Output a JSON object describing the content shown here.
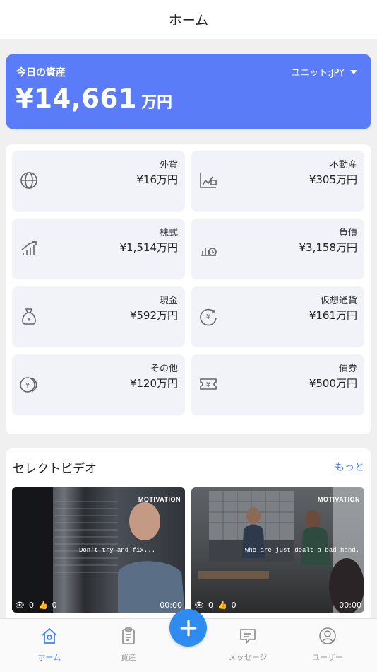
{
  "header": {
    "title": "ホーム"
  },
  "summary": {
    "label": "今日の資産",
    "unit_selector": "ユニット:JPY",
    "total": "¥14,661",
    "total_unit": "万円"
  },
  "categories": [
    {
      "name": "外貨",
      "value": "¥16万円",
      "icon": "globe-icon"
    },
    {
      "name": "不動産",
      "value": "¥305万円",
      "icon": "real-estate-chart-icon"
    },
    {
      "name": "株式",
      "value": "¥1,514万円",
      "icon": "stock-trend-icon"
    },
    {
      "name": "負債",
      "value": "¥3,158万円",
      "icon": "debt-clock-icon"
    },
    {
      "name": "現金",
      "value": "¥592万円",
      "icon": "money-bag-icon"
    },
    {
      "name": "仮想通貨",
      "value": "¥161万円",
      "icon": "crypto-yen-icon"
    },
    {
      "name": "その他",
      "value": "¥120万円",
      "icon": "coins-icon"
    },
    {
      "name": "債券",
      "value": "¥500万円",
      "icon": "bond-ticket-icon"
    }
  ],
  "videos": {
    "heading": "セレクトビデオ",
    "more_label": "もっと",
    "items": [
      {
        "tag": "MOTIVATION",
        "subtitle": "Don't try and fix...",
        "views": "0",
        "likes": "0",
        "duration": "00:00"
      },
      {
        "tag": "MOTIVATION",
        "subtitle": "who are just dealt a bad hand.",
        "views": "0",
        "likes": "0",
        "duration": "00:00"
      }
    ]
  },
  "nav": {
    "items": [
      {
        "label": "ホーム",
        "icon": "home-icon",
        "active": true
      },
      {
        "label": "資産",
        "icon": "clipboard-icon",
        "active": false
      },
      {
        "label": "メッセージ",
        "icon": "message-icon",
        "active": false
      },
      {
        "label": "ユーザー",
        "icon": "user-icon",
        "active": false
      }
    ],
    "fab_icon": "plus-icon"
  },
  "colors": {
    "accent": "#5b7cf8",
    "fab": "#2e8bf0",
    "link": "#4a7cf0",
    "nav_active": "#3b82f6"
  }
}
